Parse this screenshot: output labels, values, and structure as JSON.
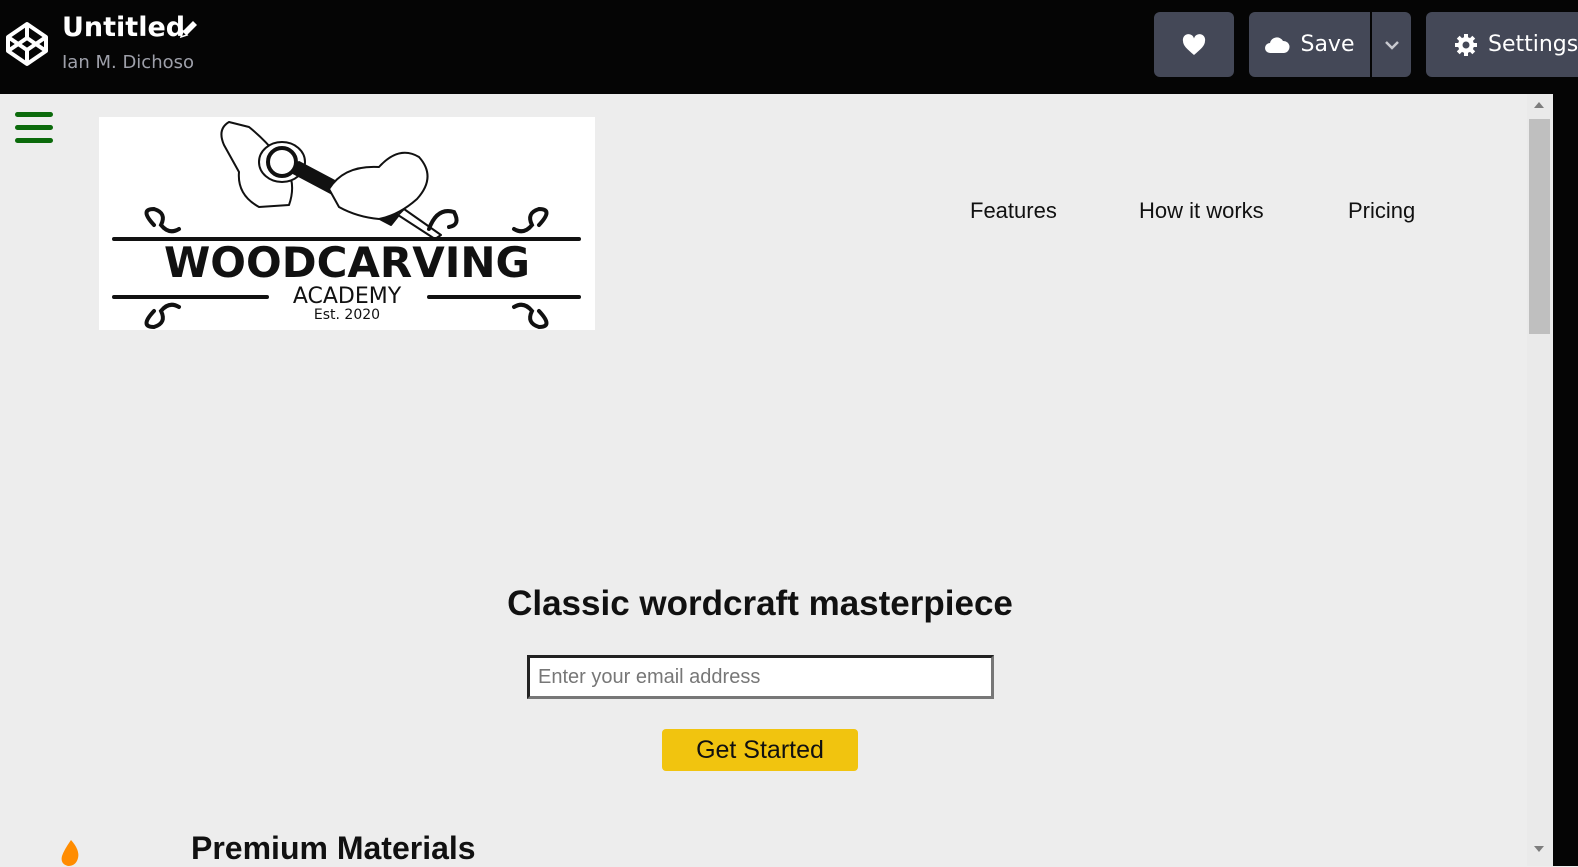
{
  "editor": {
    "title": "Untitled",
    "author": "Ian M. Dichoso",
    "save_label": "Save",
    "settings_label": "Settings"
  },
  "site": {
    "logo": {
      "line1": "WOODCARVING",
      "line2": "ACADEMY",
      "line3": "Est. 2020"
    },
    "nav": [
      "Features",
      "How it works",
      "Pricing"
    ],
    "hero": {
      "headline": "Classic wordcraft masterpiece",
      "email_placeholder": "Enter your email address",
      "cta_label": "Get Started"
    },
    "section": {
      "title": "Premium Materials"
    }
  },
  "colors": {
    "topbar": "#050505",
    "button": "#444857",
    "accent_cta": "#f1c40f",
    "hamburger": "#0b6a0b",
    "flame": "#ff8c00"
  },
  "icons": [
    "codepen-logo-icon",
    "pencil-icon",
    "heart-icon",
    "cloud-icon",
    "chevron-down-icon",
    "gear-icon",
    "hamburger-menu-icon",
    "fire-icon"
  ]
}
